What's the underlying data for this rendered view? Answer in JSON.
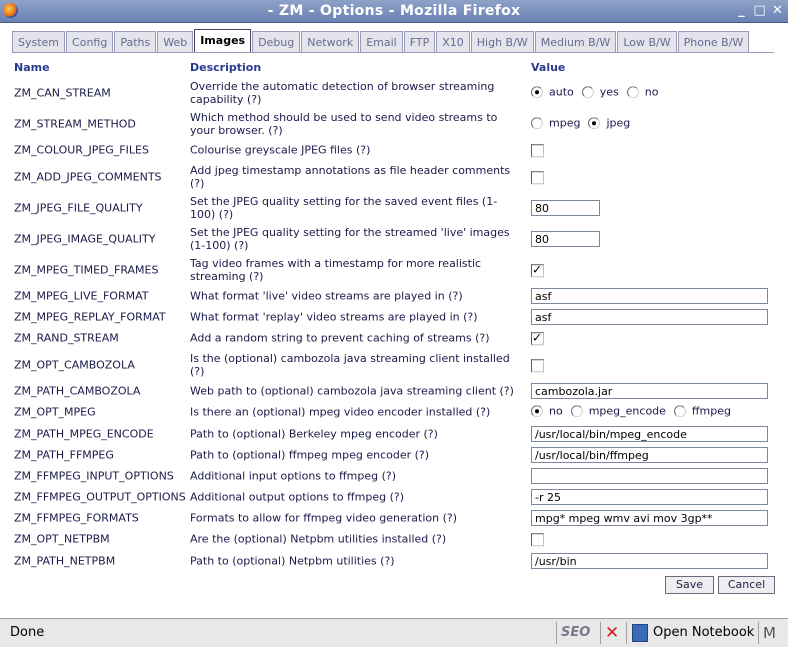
{
  "window": {
    "title": "- ZM - Options - Mozilla Firefox",
    "minimize": "_",
    "maximize": "□",
    "close": "✕"
  },
  "tabs": [
    "System",
    "Config",
    "Paths",
    "Web",
    "Images",
    "Debug",
    "Network",
    "Email",
    "FTP",
    "X10",
    "High B/W",
    "Medium B/W",
    "Low B/W",
    "Phone B/W"
  ],
  "active_tab": "Images",
  "headers": {
    "name": "Name",
    "description": "Description",
    "value": "Value"
  },
  "rows": [
    {
      "name": "ZM_CAN_STREAM",
      "desc": "Override the automatic detection of browser streaming capability (?)",
      "type": "radio",
      "options": [
        {
          "label": "auto",
          "checked": true
        },
        {
          "label": "yes",
          "checked": false
        },
        {
          "label": "no",
          "checked": false
        }
      ]
    },
    {
      "name": "ZM_STREAM_METHOD",
      "desc": "Which method should be used to send video streams to your browser. (?)",
      "type": "radio",
      "options": [
        {
          "label": "mpeg",
          "checked": false
        },
        {
          "label": "jpeg",
          "checked": true
        }
      ]
    },
    {
      "name": "ZM_COLOUR_JPEG_FILES",
      "desc": "Colourise greyscale JPEG files (?)",
      "type": "checkbox",
      "checked": false
    },
    {
      "name": "ZM_ADD_JPEG_COMMENTS",
      "desc": "Add jpeg timestamp annotations as file header comments (?)",
      "type": "checkbox",
      "checked": false
    },
    {
      "name": "ZM_JPEG_FILE_QUALITY",
      "desc": "Set the JPEG quality setting for the saved event files (1-100) (?)",
      "type": "text-short",
      "value": "80"
    },
    {
      "name": "ZM_JPEG_IMAGE_QUALITY",
      "desc": "Set the JPEG quality setting for the streamed 'live' images (1-100) (?)",
      "type": "text-short",
      "value": "80"
    },
    {
      "name": "ZM_MPEG_TIMED_FRAMES",
      "desc": "Tag video frames with a timestamp for more realistic streaming (?)",
      "type": "checkbox",
      "checked": true
    },
    {
      "name": "ZM_MPEG_LIVE_FORMAT",
      "desc": "What format 'live' video streams are played in (?)",
      "type": "text-long",
      "value": "asf"
    },
    {
      "name": "ZM_MPEG_REPLAY_FORMAT",
      "desc": "What format 'replay' video streams are played in (?)",
      "type": "text-long",
      "value": "asf"
    },
    {
      "name": "ZM_RAND_STREAM",
      "desc": "Add a random string to prevent caching of streams (?)",
      "type": "checkbox",
      "checked": true
    },
    {
      "name": "ZM_OPT_CAMBOZOLA",
      "desc": "Is the (optional) cambozola java streaming client installed (?)",
      "type": "checkbox",
      "checked": false
    },
    {
      "name": "ZM_PATH_CAMBOZOLA",
      "desc": "Web path to (optional) cambozola java streaming client (?)",
      "type": "text-long",
      "value": "cambozola.jar"
    },
    {
      "name": "ZM_OPT_MPEG",
      "desc": "Is there an (optional) mpeg video encoder installed (?)",
      "type": "radio",
      "options": [
        {
          "label": "no",
          "checked": true
        },
        {
          "label": "mpeg_encode",
          "checked": false
        },
        {
          "label": "ffmpeg",
          "checked": false
        }
      ]
    },
    {
      "name": "ZM_PATH_MPEG_ENCODE",
      "desc": "Path to (optional) Berkeley mpeg encoder (?)",
      "type": "text-long",
      "value": "/usr/local/bin/mpeg_encode"
    },
    {
      "name": "ZM_PATH_FFMPEG",
      "desc": "Path to (optional) ffmpeg mpeg encoder (?)",
      "type": "text-long",
      "value": "/usr/local/bin/ffmpeg"
    },
    {
      "name": "ZM_FFMPEG_INPUT_OPTIONS",
      "desc": "Additional input options to ffmpeg (?)",
      "type": "text-long",
      "value": ""
    },
    {
      "name": "ZM_FFMPEG_OUTPUT_OPTIONS",
      "desc": "Additional output options to ffmpeg (?)",
      "type": "text-long",
      "value": "-r 25"
    },
    {
      "name": "ZM_FFMPEG_FORMATS",
      "desc": "Formats to allow for ffmpeg video generation (?)",
      "type": "text-long",
      "value": "mpg* mpeg wmv avi mov 3gp**"
    },
    {
      "name": "ZM_OPT_NETPBM",
      "desc": "Are the (optional) Netpbm utilities installed (?)",
      "type": "checkbox",
      "checked": false
    },
    {
      "name": "ZM_PATH_NETPBM",
      "desc": "Path to (optional) Netpbm utilities (?)",
      "type": "text-long",
      "value": "/usr/bin"
    }
  ],
  "buttons": {
    "save": "Save",
    "cancel": "Cancel"
  },
  "status": {
    "text": "Done",
    "seo_label": "SEO",
    "notebook_label": "Open Notebook",
    "mail_icon": "M"
  },
  "icons": [
    "firefox-icon",
    "close-x-icon",
    "notebook-icon",
    "mail-icon"
  ]
}
